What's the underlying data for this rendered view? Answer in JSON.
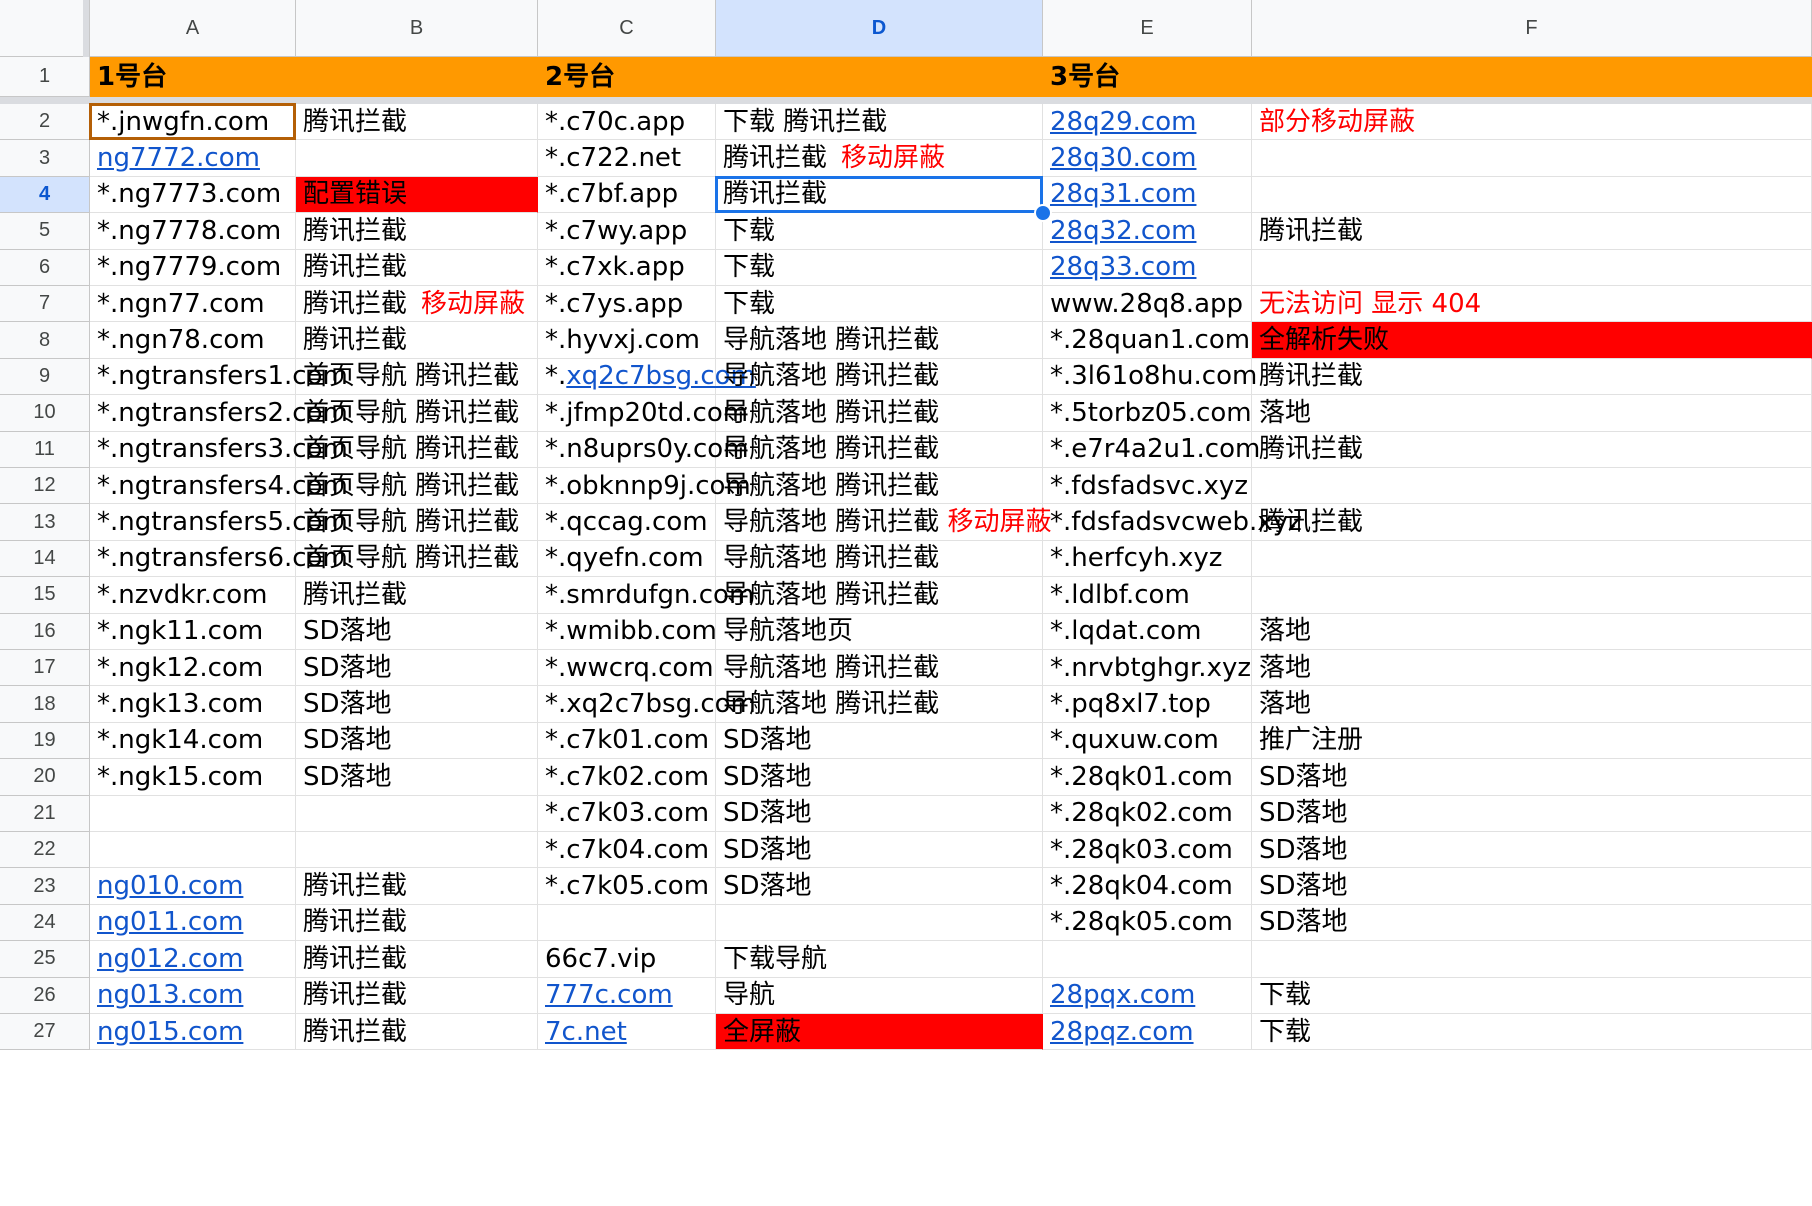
{
  "columns": [
    "A",
    "B",
    "C",
    "D",
    "E",
    "F"
  ],
  "active_column": "D",
  "active_row": 4,
  "header_row": {
    "row": 1,
    "color": "#ff9900",
    "A": "1号台",
    "C": "2号台",
    "E": "3号台"
  },
  "rows": [
    {
      "row": 2,
      "cells": {
        "A": "*.jnwgfn.com",
        "B": "腾讯拦截",
        "C": "*.c70c.app",
        "D": "下载 腾讯拦截",
        "E": {
          "link": "28q29.com"
        },
        "F": {
          "red": "部分移动屏蔽"
        }
      }
    },
    {
      "row": 3,
      "cells": {
        "A": {
          "link": "ng7772.com"
        },
        "C": "*.c722.net",
        "D": {
          "text": "腾讯拦截",
          "red": "移动屏蔽"
        },
        "E": {
          "link": "28q30.com"
        }
      }
    },
    {
      "row": 4,
      "cells": {
        "A": "*.ng7773.com",
        "B": {
          "text": "配置错误",
          "fill": "#ff0000"
        },
        "C": "*.c7bf.app",
        "D": "腾讯拦截",
        "E": {
          "link": "28q31.com"
        }
      }
    },
    {
      "row": 5,
      "cells": {
        "A": "*.ng7778.com",
        "B": "腾讯拦截",
        "C": "*.c7wy.app",
        "D": "下载",
        "E": {
          "link": "28q32.com"
        },
        "F": " 腾讯拦截"
      }
    },
    {
      "row": 6,
      "cells": {
        "A": "*.ng7779.com",
        "B": "腾讯拦截",
        "C": "*.c7xk.app",
        "D": "下载",
        "E": {
          "link": "28q33.com"
        }
      }
    },
    {
      "row": 7,
      "cells": {
        "A": "*.ngn77.com",
        "B": {
          "text": "腾讯拦截",
          "red": "移动屏蔽"
        },
        "C": "*.c7ys.app",
        "D": "下载",
        "E": "www.28q8.app",
        "F": {
          "red": "无法访问 显示 404"
        }
      }
    },
    {
      "row": 8,
      "cells": {
        "A": "*.ngn78.com",
        "B": "腾讯拦截",
        "C": "*.hyvxj.com",
        "D": "导航落地 腾讯拦截",
        "E": "*.28quan1.com",
        "F": {
          "text": "全解析失败",
          "fill": "#ff0000"
        }
      }
    },
    {
      "row": 9,
      "cells": {
        "A": "*.ngtransfers1.com",
        "B": "首页导航 腾讯拦截",
        "C": {
          "text": "*.",
          "link": "xq2c7bsg.com"
        },
        "D": "导航落地 腾讯拦截",
        "E": "*.3l61o8hu.com",
        "F": " 腾讯拦截"
      }
    },
    {
      "row": 10,
      "cells": {
        "A": "*.ngtransfers2.com",
        "B": "首页导航 腾讯拦截",
        "C": "*.jfmp20td.com",
        "D": "导航落地 腾讯拦截",
        "E": "*.5torbz05.com",
        "F": "落地"
      }
    },
    {
      "row": 11,
      "cells": {
        "A": "*.ngtransfers3.com",
        "B": "首页导航 腾讯拦截",
        "C": "*.n8uprs0y.com",
        "D": "导航落地 腾讯拦截",
        "E": "*.e7r4a2u1.com",
        "F": " 腾讯拦截"
      }
    },
    {
      "row": 12,
      "cells": {
        "A": "*.ngtransfers4.com",
        "B": "首页导航 腾讯拦截",
        "C": "*.obknnp9j.com",
        "D": "导航落地 腾讯拦截",
        "E": "*.fdsfadsvc.xyz"
      }
    },
    {
      "row": 13,
      "cells": {
        "A": "*.ngtransfers5.com",
        "B": "首页导航 腾讯拦截",
        "C": "*.qccag.com",
        "D": {
          "text": "导航落地 腾讯拦截 ",
          "red": "移动屏蔽"
        },
        "E": "*.fdsfadsvcweb.xyz",
        "F": " 腾讯拦截"
      }
    },
    {
      "row": 14,
      "cells": {
        "A": "*.ngtransfers6.com",
        "B": "首页导航 腾讯拦截",
        "C": "*.qyefn.com",
        "D": "导航落地 腾讯拦截",
        "E": "*.herfcyh.xyz"
      }
    },
    {
      "row": 15,
      "cells": {
        "A": "*.nzvdkr.com",
        "B": "腾讯拦截",
        "C": "*.smrdufgn.com",
        "D": "导航落地 腾讯拦截",
        "E": "*.ldlbf.com"
      }
    },
    {
      "row": 16,
      "cells": {
        "A": "*.ngk11.com",
        "B": "SD落地",
        "C": "*.wmibb.com",
        "D": "导航落地页",
        "E": "*.lqdat.com",
        "F": "落地"
      }
    },
    {
      "row": 17,
      "cells": {
        "A": "*.ngk12.com",
        "B": "SD落地",
        "C": "*.wwcrq.com",
        "D": "导航落地 腾讯拦截",
        "E": "*.nrvbtghgr.xyz",
        "F": "落地"
      }
    },
    {
      "row": 18,
      "cells": {
        "A": "*.ngk13.com",
        "B": "SD落地",
        "C": "*.xq2c7bsg.com",
        "D": "导航落地 腾讯拦截",
        "E": "*.pq8xl7.top",
        "F": "落地"
      }
    },
    {
      "row": 19,
      "cells": {
        "A": "*.ngk14.com",
        "B": "SD落地",
        "C": "*.c7k01.com",
        "D": "SD落地",
        "E": "*.quxuw.com",
        "F": "推广注册"
      }
    },
    {
      "row": 20,
      "cells": {
        "A": "*.ngk15.com",
        "B": "SD落地",
        "C": "*.c7k02.com",
        "D": "SD落地",
        "E": "*.28qk01.com",
        "F": "SD落地"
      }
    },
    {
      "row": 21,
      "cells": {
        "C": "*.c7k03.com",
        "D": "SD落地",
        "E": "*.28qk02.com",
        "F": "SD落地"
      }
    },
    {
      "row": 22,
      "cells": {
        "C": "*.c7k04.com",
        "D": "SD落地",
        "E": "*.28qk03.com",
        "F": "SD落地"
      }
    },
    {
      "row": 23,
      "cells": {
        "A": {
          "link": "ng010.com"
        },
        "B": "腾讯拦截",
        "C": "*.c7k05.com",
        "D": "SD落地",
        "E": "*.28qk04.com",
        "F": "SD落地"
      }
    },
    {
      "row": 24,
      "cells": {
        "A": {
          "link": "ng011.com"
        },
        "B": "腾讯拦截",
        "E": "*.28qk05.com",
        "F": "SD落地"
      }
    },
    {
      "row": 25,
      "cells": {
        "A": {
          "link": "ng012.com"
        },
        "B": "腾讯拦截",
        "C": "66c7.vip",
        "D": "下载导航"
      }
    },
    {
      "row": 26,
      "cells": {
        "A": {
          "link": "ng013.com"
        },
        "B": "腾讯拦截",
        "C": {
          "link": "777c.com"
        },
        "D": "导航",
        "E": {
          "link": "28pqx.com"
        },
        "F": "下载"
      }
    },
    {
      "row": 27,
      "cells": {
        "A": {
          "link": "ng015.com"
        },
        "B": "腾讯拦截",
        "C": {
          "link": "7c.net"
        },
        "D": {
          "text": "全屏蔽",
          "fill": "#ff0000"
        },
        "E": {
          "link": "28pqz.com"
        },
        "F": "下载"
      }
    }
  ],
  "colors": {
    "header_fill": "#ff9900",
    "red_text": "#ff0000",
    "red_fill": "#ff0000",
    "link": "#1155cc",
    "selection": "#1a73e8"
  }
}
